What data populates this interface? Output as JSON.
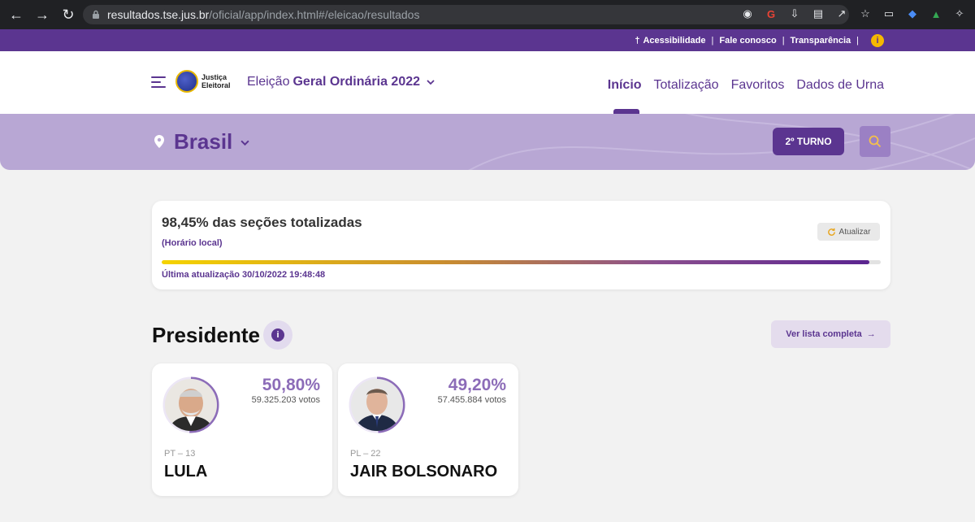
{
  "browser": {
    "url_host": "resultados.tse.jus.br",
    "url_path": "/oficial/app/index.html#/eleicao/resultados"
  },
  "utility_bar": {
    "links": [
      "Acessibilidade",
      "Fale conosco",
      "Transparência"
    ],
    "info_icon": "info-icon"
  },
  "header": {
    "logo_line1": "Justiça",
    "logo_line2": "Eleitoral",
    "election_prefix": "Eleição",
    "election_name": "Geral Ordinária 2022",
    "nav": [
      {
        "label": "Início",
        "active": true
      },
      {
        "label": "Totalização",
        "active": false
      },
      {
        "label": "Favoritos",
        "active": false
      },
      {
        "label": "Dados de Urna",
        "active": false
      }
    ]
  },
  "location": {
    "name": "Brasil",
    "turn_button": "2º TURNO"
  },
  "progress": {
    "title": "98,45% das seções totalizadas",
    "subtitle": "(Horário local)",
    "refresh_label": "Atualizar",
    "fraction": 0.9845,
    "updated": "Última atualização 30/10/2022 19:48:48"
  },
  "president": {
    "title": "Presidente",
    "list_button": "Ver lista completa",
    "candidates": [
      {
        "pct": "50,80%",
        "fraction": 0.508,
        "votes": "59.325.203 votos",
        "party": "PT – 13",
        "name": "LULA"
      },
      {
        "pct": "49,20%",
        "fraction": 0.492,
        "votes": "57.455.884 votos",
        "party": "PL – 22",
        "name": "JAIR BOLSONARO"
      }
    ]
  },
  "colors": {
    "primary": "#5b3590",
    "band": "#b8a7d4",
    "pct": "#8c6cb8",
    "warn": "#f5b800"
  }
}
